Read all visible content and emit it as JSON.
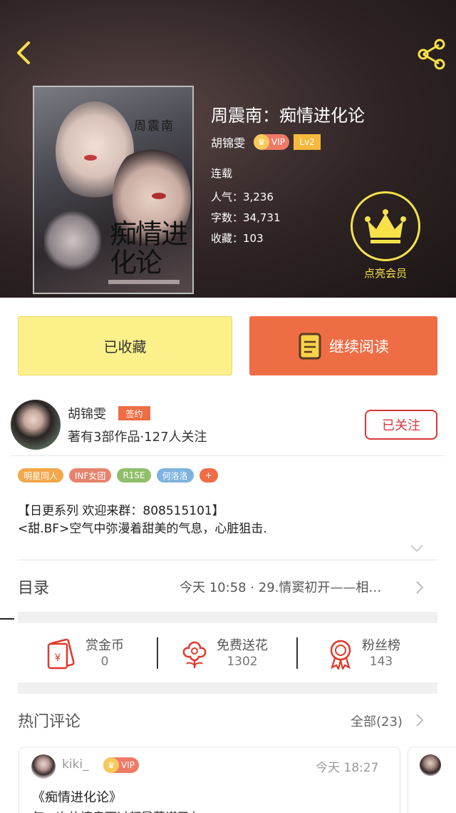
{
  "book": {
    "title": "周震南：痴情进化论",
    "author": "胡锦雯",
    "vip": "VIP",
    "level": "Lv2",
    "status": "连载",
    "popularity": "人气：3,236",
    "words": "字数：34,731",
    "favorites": "收藏：103",
    "vip_cta": "点亮会员",
    "cover": {
      "title": "周震南",
      "big_text": "痴情进化论"
    }
  },
  "actions": {
    "collected": "已收藏",
    "continue_reading": "继续阅读"
  },
  "author_card": {
    "name": "胡锦雯",
    "badge": "签约",
    "meta": "著有3部作品·127人关注",
    "follow": "已关注"
  },
  "tags": [
    {
      "label": "明星同人",
      "color": "#f3a84a"
    },
    {
      "label": "INF女团",
      "color": "#e6836d"
    },
    {
      "label": "R1SE",
      "color": "#8fbf6a"
    },
    {
      "label": "何洛洛",
      "color": "#7fb3df"
    },
    {
      "label": "+",
      "color": "#ee6d45"
    }
  ],
  "description": {
    "line1": "【日更系列 欢迎来群：808515101】",
    "line2": "<甜.BF>空气中弥漫着甜美的气息，心脏狙击."
  },
  "toc": {
    "label": "目录",
    "latest": "今天 10:58 · 29.情窦初开——相…"
  },
  "stats_row": {
    "coins_label": "赏金币",
    "coins_value": "0",
    "flowers_label": "免费送花",
    "flowers_value": "1302",
    "fans_label": "粉丝榜",
    "fans_value": "143"
  },
  "hot_comments": {
    "label": "热门评论",
    "all": "全部(23)",
    "first": {
      "user": "kiki_",
      "vip": "VIP",
      "time": "今天 18:27",
      "text": "《痴情进化论》",
      "text2": "每一次的擦肩而过都是蓄谋已久"
    }
  },
  "colors": {
    "accent": "#ee6d45",
    "collected_bg": "#fbf08a",
    "vip_gold": "#f7e24a",
    "follow_red": "#d9383a"
  }
}
